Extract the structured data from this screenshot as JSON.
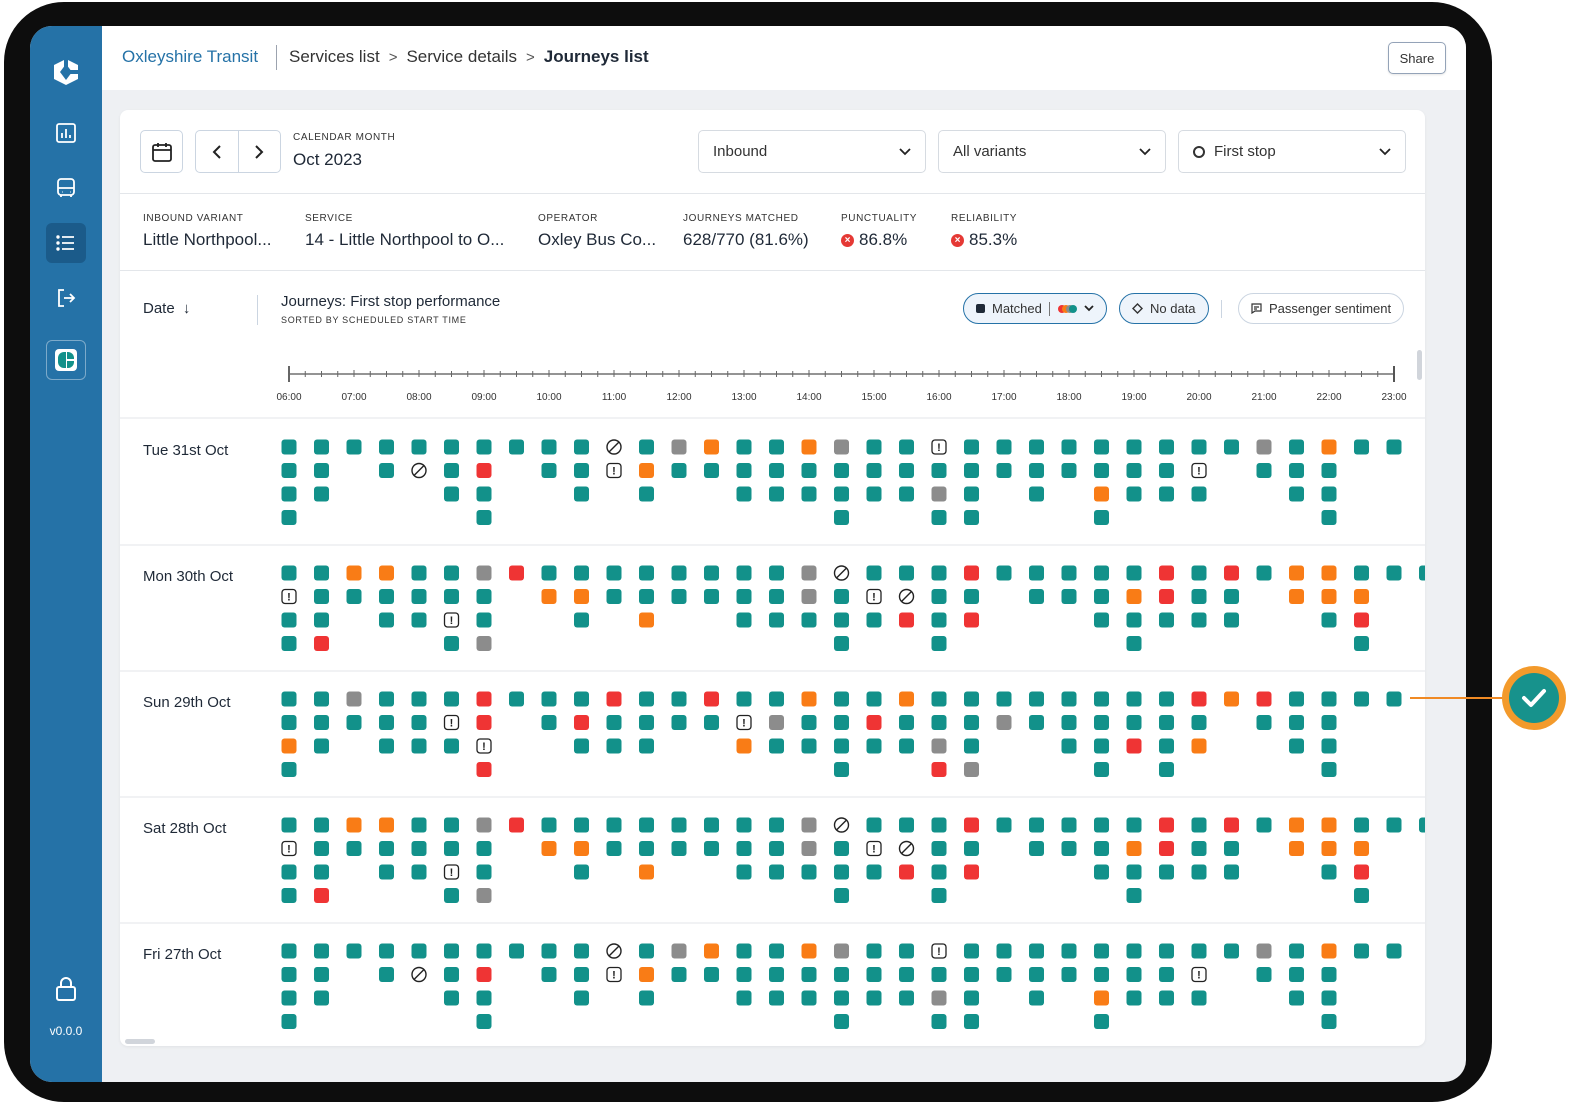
{
  "app": {
    "brand": "Oxleyshire Transit",
    "breadcrumb": [
      "Services list",
      "Service details",
      "Journeys list"
    ],
    "share_label": "Share",
    "version": "v0.0.0"
  },
  "sidebar": {
    "items": [
      {
        "name": "reports-icon",
        "active": false
      },
      {
        "name": "bus-icon",
        "active": false
      },
      {
        "name": "list-icon",
        "active": true
      },
      {
        "name": "logout-icon",
        "active": false
      }
    ]
  },
  "filters": {
    "calendar_label": "CALENDAR MONTH",
    "calendar_value": "Oct 2023",
    "direction": "Inbound",
    "variants": "All variants",
    "stop": "First stop"
  },
  "stats": [
    {
      "key": "INBOUND VARIANT",
      "value": "Little Northpool..."
    },
    {
      "key": "SERVICE",
      "value": "14 - Little Northpool to O..."
    },
    {
      "key": "OPERATOR",
      "value": "Oxley Bus Co..."
    },
    {
      "key": "JOURNEYS MATCHED",
      "value": "628/770 (81.6%)"
    },
    {
      "key": "PUNCTUALITY",
      "value": "86.8%",
      "bad": true
    },
    {
      "key": "RELIABILITY",
      "value": "85.3%",
      "bad": true
    }
  ],
  "list_header": {
    "sort_label": "Date",
    "title": "Journeys: First stop performance",
    "subtitle": "SORTED BY SCHEDULED START TIME",
    "matched_label": "Matched",
    "nodata_label": "No data",
    "sentiment_label": "Passenger sentiment"
  },
  "timeline": {
    "hours": [
      "06:00",
      "07:00",
      "08:00",
      "09:00",
      "10:00",
      "11:00",
      "12:00",
      "13:00",
      "14:00",
      "15:00",
      "16:00",
      "17:00",
      "18:00",
      "19:00",
      "20:00",
      "21:00",
      "22:00",
      "23:00"
    ]
  },
  "colors": {
    "on_time": "#12918a",
    "late": "#f97c16",
    "cancelled": "#ef3434",
    "no_data": "#8c8c8c",
    "brand": "#2572a7"
  },
  "legend_codes": {
    "g": "on_time",
    "o": "late",
    "r": "cancelled",
    "x": "no_data",
    "c": "not_operated",
    "w": "warning"
  },
  "days": [
    {
      "label": "Tue 31st Oct",
      "columns": [
        "gggg",
        "ggg",
        "g",
        "gg",
        "gc",
        "ggg",
        "grgg",
        "g",
        "gg",
        "ggg",
        "cw",
        "gog",
        "xg",
        "og",
        "ggg",
        "ggg",
        "ogg",
        "xggg",
        "ggg",
        "ggg",
        "wgxg",
        "gggg",
        "gg",
        "ggg",
        "gg",
        "ggog",
        "ggg",
        "ggg",
        "gwg",
        "g",
        "xg",
        "ggg",
        "oggg",
        "g",
        "g"
      ]
    },
    {
      "label": "Mon 30th Oct",
      "columns": [
        "gwgg",
        "gggr",
        "og",
        "ogg",
        "ggg",
        "ggwg",
        "xggx",
        "r",
        "go",
        "gog",
        "gg",
        "ggo",
        "gg",
        "gg",
        "ggg",
        "ggg",
        "xxg",
        "cggg",
        "gwg",
        "gcr",
        "gggg",
        "rgr",
        "g",
        "gg",
        "gg",
        "ggg",
        "gogg",
        "rrg",
        "ggg",
        "rgg",
        "g",
        "oo",
        "oog",
        "gorо",
        "g",
        "g"
      ]
    },
    {
      "label": "Sun 29th Oct",
      "columns": [
        "ggog",
        "ggg",
        "xg",
        "ggg",
        "ggg",
        "gwg",
        "rrwr",
        "g",
        "gg",
        "grg",
        "rgg",
        "ggg",
        "gg",
        "rg",
        "gwo",
        "gxg",
        "ogg",
        "gggg",
        "grg",
        "ogg",
        "ggxr",
        "gggx",
        "gx",
        "gg",
        "ggg",
        "gggg",
        "ggr",
        "gggg",
        "rgo",
        "o",
        "rg",
        "ggg",
        "gggg",
        "g",
        "g"
      ]
    },
    {
      "label": "Sat 28th Oct",
      "columns": [
        "gwgg",
        "gggr",
        "og",
        "ogg",
        "ggg",
        "ggwg",
        "xggx",
        "r",
        "go",
        "gog",
        "gg",
        "ggo",
        "gg",
        "gg",
        "ggg",
        "ggg",
        "xxg",
        "cggg",
        "gwg",
        "gcr",
        "gggg",
        "rgr",
        "g",
        "gg",
        "gg",
        "ggg",
        "gogg",
        "rrg",
        "ggg",
        "rgg",
        "g",
        "oo",
        "oog",
        "gorо",
        "g",
        "g"
      ]
    },
    {
      "label": "Fri 27th Oct",
      "columns": [
        "gggg",
        "ggg",
        "g",
        "gg",
        "gc",
        "ggg",
        "grgg",
        "g",
        "gg",
        "ggg",
        "cw",
        "gog",
        "xg",
        "og",
        "ggg",
        "ggg",
        "ogg",
        "xggg",
        "ggg",
        "ggg",
        "wgxg",
        "gggg",
        "gg",
        "ggg",
        "gg",
        "ggog",
        "ggg",
        "ggg",
        "gwg",
        "g",
        "xg",
        "ggg",
        "oggg",
        "g",
        "g"
      ]
    }
  ],
  "callout": {
    "icon": "check-icon"
  }
}
